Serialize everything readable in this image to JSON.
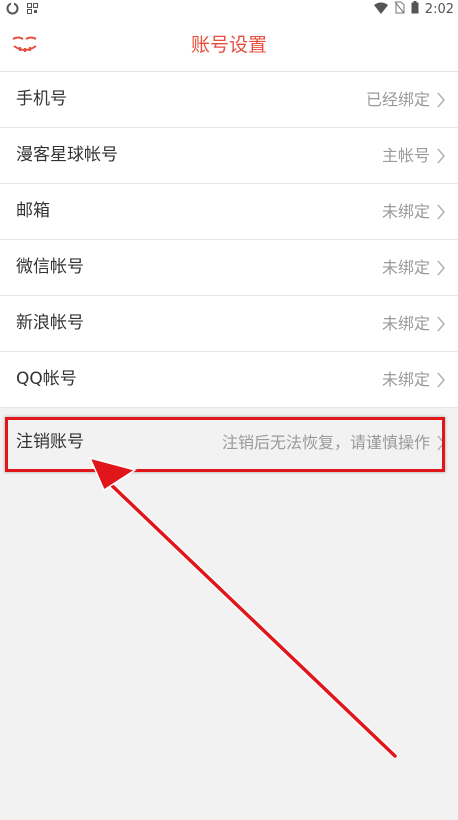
{
  "status_bar": {
    "time": "2:02",
    "icons": [
      "sync-icon",
      "qr-icon",
      "wifi-icon",
      "no-sim-icon",
      "battery-icon"
    ]
  },
  "header": {
    "title": "账号设置",
    "back_icon": "back-icon"
  },
  "settings": {
    "items": [
      {
        "label": "手机号",
        "value": "已经绑定"
      },
      {
        "label": "漫客星球帐号",
        "value": "主帐号"
      },
      {
        "label": "邮箱",
        "value": "未绑定"
      },
      {
        "label": "微信帐号",
        "value": "未绑定"
      },
      {
        "label": "新浪帐号",
        "value": "未绑定"
      },
      {
        "label": "QQ帐号",
        "value": "未绑定"
      }
    ]
  },
  "cancel_account": {
    "label": "注销账号",
    "value": "注销后无法恢复，请谨慎操作"
  },
  "colors": {
    "accent": "#e84d3d",
    "annotation": "#e0161b",
    "background": "#f2f2f2"
  }
}
